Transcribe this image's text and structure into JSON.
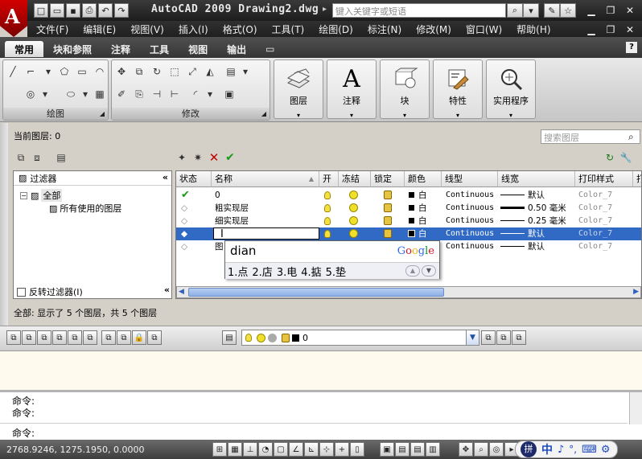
{
  "window": {
    "title": "AutoCAD 2009  Drawing2.dwg",
    "search_placeholder": "键入关键字或短语",
    "logo_letter": "A"
  },
  "menu": [
    "文件(F)",
    "编辑(E)",
    "视图(V)",
    "插入(I)",
    "格式(O)",
    "工具(T)",
    "绘图(D)",
    "标注(N)",
    "修改(M)",
    "窗口(W)",
    "帮助(H)"
  ],
  "ribbon_tabs": [
    {
      "label": "常用",
      "active": true
    },
    {
      "label": "块和参照",
      "active": false
    },
    {
      "label": "注释",
      "active": false
    },
    {
      "label": "工具",
      "active": false
    },
    {
      "label": "视图",
      "active": false
    },
    {
      "label": "输出",
      "active": false
    }
  ],
  "ribbon": {
    "panel_draw": "绘图",
    "panel_modify": "修改",
    "big_buttons": [
      {
        "label": "图层",
        "icon": "layers-icon"
      },
      {
        "label": "注释",
        "icon": "annotation-icon"
      },
      {
        "label": "块",
        "icon": "block-icon"
      },
      {
        "label": "特性",
        "icon": "properties-icon"
      },
      {
        "label": "实用程序",
        "icon": "utilities-icon"
      }
    ],
    "annotation_glyph": "A",
    "help_glyph": "?"
  },
  "layer_manager": {
    "current_layer_label": "当前图层: 0",
    "search_placeholder": "搜索图层",
    "filter_tree_header": "过滤器",
    "filter_all": "全部",
    "filter_used": "所有使用的图层",
    "invert_filter": "反转过滤器(I)",
    "columns": [
      "状态",
      "名称",
      "开",
      "冻结",
      "锁定",
      "颜色",
      "线型",
      "线宽",
      "打印样式",
      "打"
    ],
    "rows": [
      {
        "name": "0",
        "color": "白",
        "linetype": "Continuous",
        "lineweight": "默认",
        "plotstyle": "Color_7",
        "current": true,
        "selected": false,
        "thick": false
      },
      {
        "name": "粗实现层",
        "color": "白",
        "linetype": "Continuous",
        "lineweight": "0.50 毫米",
        "plotstyle": "Color_7",
        "current": false,
        "selected": false,
        "thick": true
      },
      {
        "name": "细实现层",
        "color": "白",
        "linetype": "Continuous",
        "lineweight": "0.25 毫米",
        "plotstyle": "Color_7",
        "current": false,
        "selected": false,
        "thick": false
      },
      {
        "name": "",
        "color": "白",
        "linetype": "Continuous",
        "lineweight": "默认",
        "plotstyle": "Color_7",
        "current": false,
        "selected": true,
        "thick": false
      },
      {
        "name": "图",
        "color": "",
        "linetype": "Continuous",
        "lineweight": "默认",
        "plotstyle": "Color_7",
        "current": false,
        "selected": false,
        "thick": false
      }
    ],
    "summary": "全部: 显示了 5 个图层，共 5 个图层"
  },
  "ime": {
    "input": "dian",
    "brand": "Google",
    "candidates": [
      "1.点",
      "2.店",
      "3.电",
      "4.掂",
      "5.垫"
    ]
  },
  "layer_toolbar": {
    "current_layer": "0"
  },
  "command": {
    "lines": [
      "命令:",
      "命令:"
    ],
    "prompt": "命令:"
  },
  "status": {
    "coords": "2768.9246, 1275.1950, 0.0000",
    "ime_chars": [
      "中",
      "♪",
      "°,",
      "⌨"
    ]
  },
  "colors": {
    "selection": "#316ac5",
    "title_bg": "#2a2a2a",
    "accent_red": "#c00000"
  }
}
